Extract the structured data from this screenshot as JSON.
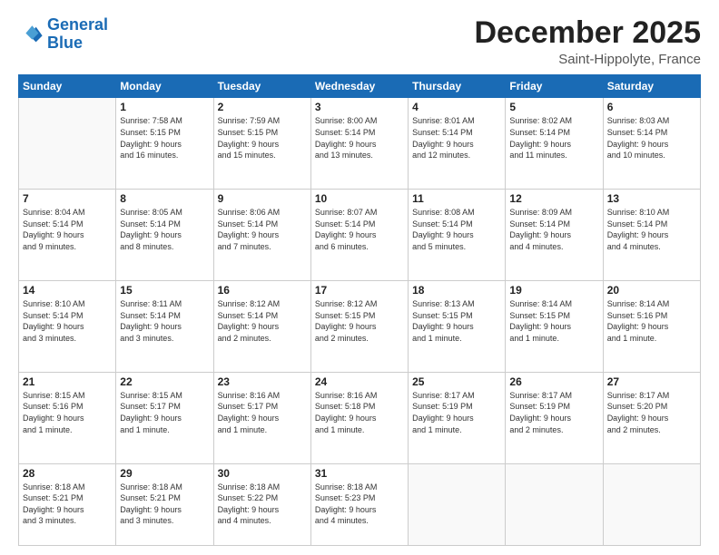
{
  "header": {
    "logo_line1": "General",
    "logo_line2": "Blue",
    "month": "December 2025",
    "location": "Saint-Hippolyte, France"
  },
  "weekdays": [
    "Sunday",
    "Monday",
    "Tuesday",
    "Wednesday",
    "Thursday",
    "Friday",
    "Saturday"
  ],
  "weeks": [
    [
      {
        "day": "",
        "info": ""
      },
      {
        "day": "1",
        "info": "Sunrise: 7:58 AM\nSunset: 5:15 PM\nDaylight: 9 hours\nand 16 minutes."
      },
      {
        "day": "2",
        "info": "Sunrise: 7:59 AM\nSunset: 5:15 PM\nDaylight: 9 hours\nand 15 minutes."
      },
      {
        "day": "3",
        "info": "Sunrise: 8:00 AM\nSunset: 5:14 PM\nDaylight: 9 hours\nand 13 minutes."
      },
      {
        "day": "4",
        "info": "Sunrise: 8:01 AM\nSunset: 5:14 PM\nDaylight: 9 hours\nand 12 minutes."
      },
      {
        "day": "5",
        "info": "Sunrise: 8:02 AM\nSunset: 5:14 PM\nDaylight: 9 hours\nand 11 minutes."
      },
      {
        "day": "6",
        "info": "Sunrise: 8:03 AM\nSunset: 5:14 PM\nDaylight: 9 hours\nand 10 minutes."
      }
    ],
    [
      {
        "day": "7",
        "info": "Sunrise: 8:04 AM\nSunset: 5:14 PM\nDaylight: 9 hours\nand 9 minutes."
      },
      {
        "day": "8",
        "info": "Sunrise: 8:05 AM\nSunset: 5:14 PM\nDaylight: 9 hours\nand 8 minutes."
      },
      {
        "day": "9",
        "info": "Sunrise: 8:06 AM\nSunset: 5:14 PM\nDaylight: 9 hours\nand 7 minutes."
      },
      {
        "day": "10",
        "info": "Sunrise: 8:07 AM\nSunset: 5:14 PM\nDaylight: 9 hours\nand 6 minutes."
      },
      {
        "day": "11",
        "info": "Sunrise: 8:08 AM\nSunset: 5:14 PM\nDaylight: 9 hours\nand 5 minutes."
      },
      {
        "day": "12",
        "info": "Sunrise: 8:09 AM\nSunset: 5:14 PM\nDaylight: 9 hours\nand 4 minutes."
      },
      {
        "day": "13",
        "info": "Sunrise: 8:10 AM\nSunset: 5:14 PM\nDaylight: 9 hours\nand 4 minutes."
      }
    ],
    [
      {
        "day": "14",
        "info": "Sunrise: 8:10 AM\nSunset: 5:14 PM\nDaylight: 9 hours\nand 3 minutes."
      },
      {
        "day": "15",
        "info": "Sunrise: 8:11 AM\nSunset: 5:14 PM\nDaylight: 9 hours\nand 3 minutes."
      },
      {
        "day": "16",
        "info": "Sunrise: 8:12 AM\nSunset: 5:14 PM\nDaylight: 9 hours\nand 2 minutes."
      },
      {
        "day": "17",
        "info": "Sunrise: 8:12 AM\nSunset: 5:15 PM\nDaylight: 9 hours\nand 2 minutes."
      },
      {
        "day": "18",
        "info": "Sunrise: 8:13 AM\nSunset: 5:15 PM\nDaylight: 9 hours\nand 1 minute."
      },
      {
        "day": "19",
        "info": "Sunrise: 8:14 AM\nSunset: 5:15 PM\nDaylight: 9 hours\nand 1 minute."
      },
      {
        "day": "20",
        "info": "Sunrise: 8:14 AM\nSunset: 5:16 PM\nDaylight: 9 hours\nand 1 minute."
      }
    ],
    [
      {
        "day": "21",
        "info": "Sunrise: 8:15 AM\nSunset: 5:16 PM\nDaylight: 9 hours\nand 1 minute."
      },
      {
        "day": "22",
        "info": "Sunrise: 8:15 AM\nSunset: 5:17 PM\nDaylight: 9 hours\nand 1 minute."
      },
      {
        "day": "23",
        "info": "Sunrise: 8:16 AM\nSunset: 5:17 PM\nDaylight: 9 hours\nand 1 minute."
      },
      {
        "day": "24",
        "info": "Sunrise: 8:16 AM\nSunset: 5:18 PM\nDaylight: 9 hours\nand 1 minute."
      },
      {
        "day": "25",
        "info": "Sunrise: 8:17 AM\nSunset: 5:19 PM\nDaylight: 9 hours\nand 1 minute."
      },
      {
        "day": "26",
        "info": "Sunrise: 8:17 AM\nSunset: 5:19 PM\nDaylight: 9 hours\nand 2 minutes."
      },
      {
        "day": "27",
        "info": "Sunrise: 8:17 AM\nSunset: 5:20 PM\nDaylight: 9 hours\nand 2 minutes."
      }
    ],
    [
      {
        "day": "28",
        "info": "Sunrise: 8:18 AM\nSunset: 5:21 PM\nDaylight: 9 hours\nand 3 minutes."
      },
      {
        "day": "29",
        "info": "Sunrise: 8:18 AM\nSunset: 5:21 PM\nDaylight: 9 hours\nand 3 minutes."
      },
      {
        "day": "30",
        "info": "Sunrise: 8:18 AM\nSunset: 5:22 PM\nDaylight: 9 hours\nand 4 minutes."
      },
      {
        "day": "31",
        "info": "Sunrise: 8:18 AM\nSunset: 5:23 PM\nDaylight: 9 hours\nand 4 minutes."
      },
      {
        "day": "",
        "info": ""
      },
      {
        "day": "",
        "info": ""
      },
      {
        "day": "",
        "info": ""
      }
    ]
  ]
}
